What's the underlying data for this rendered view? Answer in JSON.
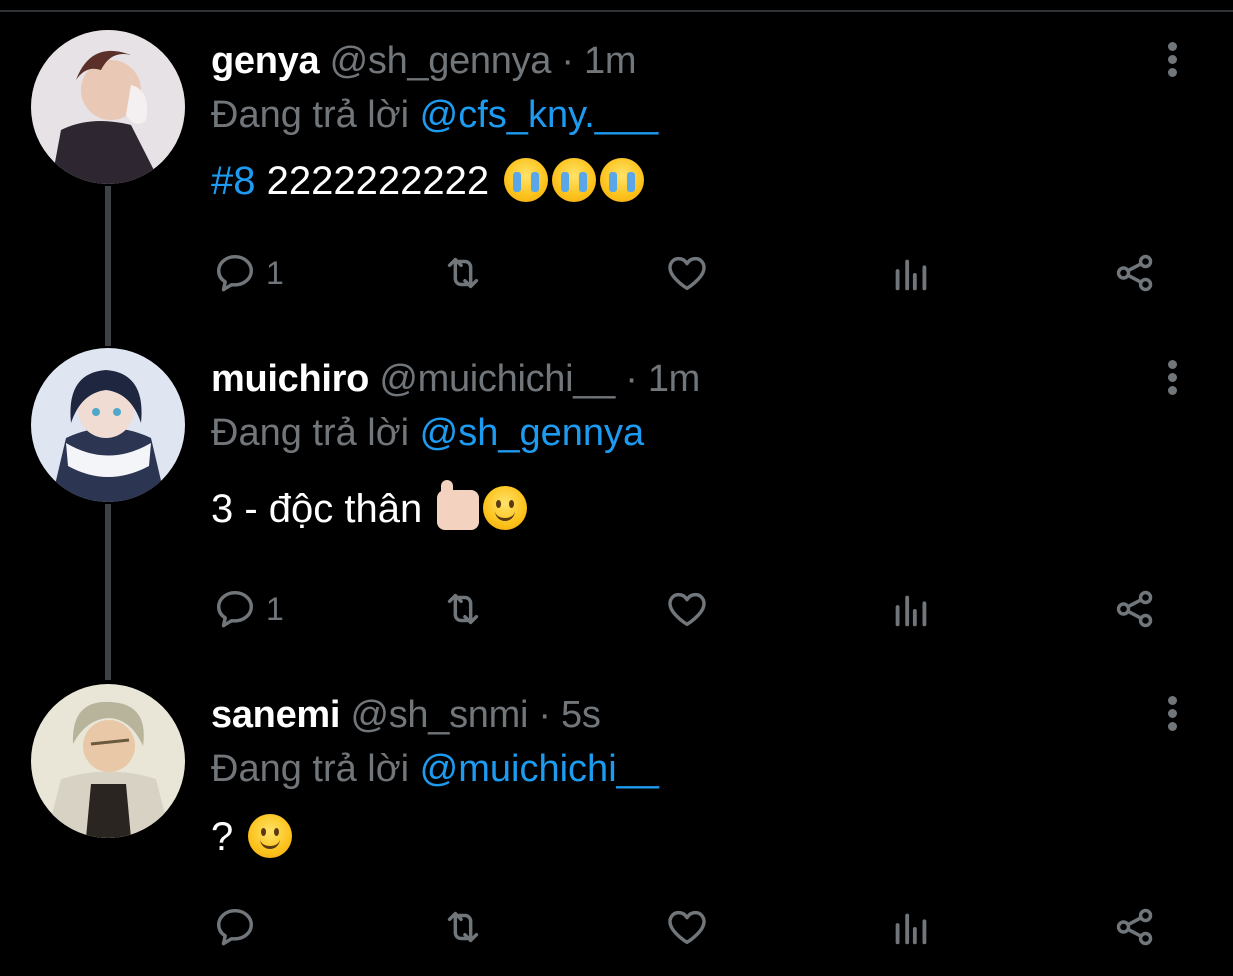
{
  "colors": {
    "background": "#000000",
    "accent": "#1d9bf0",
    "muted": "#71767b",
    "text": "#ffffff"
  },
  "tweets": [
    {
      "name": "genya",
      "handle": "@sh_gennya",
      "dot": " · ",
      "time": "1m",
      "reply_prefix": "Đang trả lời ",
      "reply_to": "@cfs_kny.___",
      "hashtag": "#8",
      "text": " 2222222222",
      "emojis": [
        "loudly-crying-face",
        "loudly-crying-face",
        "loudly-crying-face"
      ],
      "reply_count": "1",
      "icons": [
        "reply-icon",
        "retweet-icon",
        "like-icon",
        "analytics-icon",
        "share-icon"
      ]
    },
    {
      "name": "muichiro",
      "handle": "@muichichi__",
      "dot": " · ",
      "time": "1m",
      "reply_prefix": "Đang trả lời ",
      "reply_to": "@sh_gennya",
      "text": "3 - độc thân ",
      "emojis": [
        "thumbs-up",
        "slightly-smiling-face"
      ],
      "reply_count": "1",
      "icons": [
        "reply-icon",
        "retweet-icon",
        "like-icon",
        "analytics-icon",
        "share-icon"
      ]
    },
    {
      "name": "sanemi",
      "handle": "@sh_snmi",
      "dot": " · ",
      "time": "5s",
      "reply_prefix": "Đang trả lời ",
      "reply_to": "@muichichi__",
      "text": "? ",
      "emojis": [
        "slightly-smiling-face"
      ],
      "reply_count": "",
      "icons": [
        "reply-icon",
        "retweet-icon",
        "like-icon",
        "analytics-icon",
        "share-icon"
      ]
    }
  ]
}
